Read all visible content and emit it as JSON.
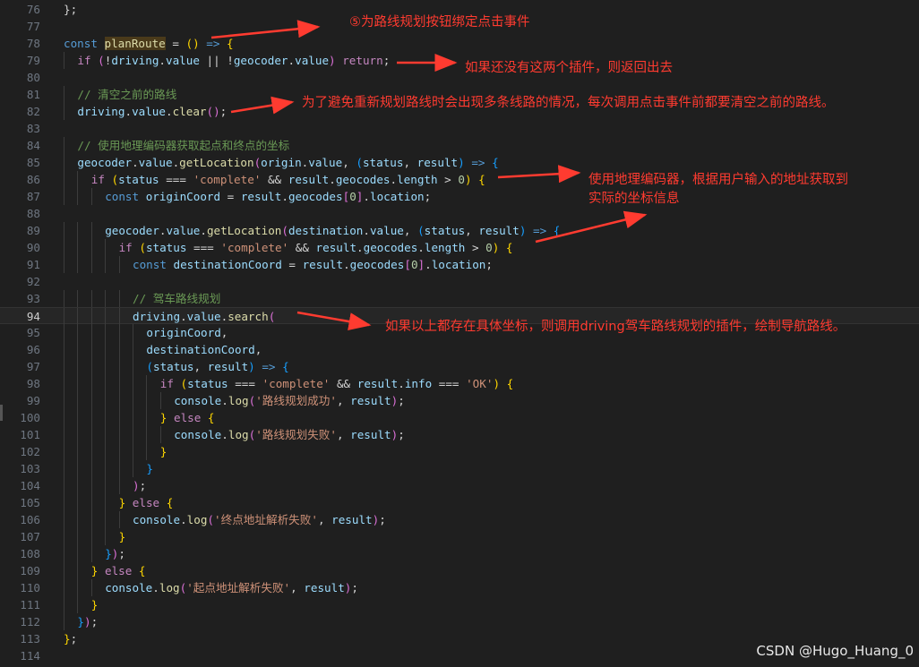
{
  "editor": {
    "active_line": 94,
    "lines": [
      {
        "no": 76,
        "indent": 0,
        "tokens": [
          [
            "p",
            "};"
          ]
        ]
      },
      {
        "no": 77,
        "indent": 0,
        "tokens": []
      },
      {
        "no": 78,
        "indent": 0,
        "tokens": [
          [
            "k",
            "const "
          ],
          [
            "hl",
            "planRoute"
          ],
          [
            "p",
            " = "
          ],
          [
            "b1",
            "()"
          ],
          [
            "p",
            " "
          ],
          [
            "k",
            "=>"
          ],
          [
            "p",
            " "
          ],
          [
            "b1",
            "{"
          ]
        ]
      },
      {
        "no": 79,
        "indent": 1,
        "tokens": [
          [
            "c",
            "if "
          ],
          [
            "b2",
            "("
          ],
          [
            "p",
            "!"
          ],
          [
            "v",
            "driving"
          ],
          [
            "p",
            "."
          ],
          [
            "v",
            "value"
          ],
          [
            "p",
            " || !"
          ],
          [
            "v",
            "geocoder"
          ],
          [
            "p",
            "."
          ],
          [
            "v",
            "value"
          ],
          [
            "b2",
            ")"
          ],
          [
            "p",
            " "
          ],
          [
            "c",
            "return"
          ],
          [
            "p",
            ";"
          ]
        ]
      },
      {
        "no": 80,
        "indent": 0,
        "tokens": []
      },
      {
        "no": 81,
        "indent": 1,
        "tokens": [
          [
            "cm",
            "// 清空之前的路线"
          ]
        ]
      },
      {
        "no": 82,
        "indent": 1,
        "tokens": [
          [
            "v",
            "driving"
          ],
          [
            "p",
            "."
          ],
          [
            "v",
            "value"
          ],
          [
            "p",
            "."
          ],
          [
            "f",
            "clear"
          ],
          [
            "b2",
            "()"
          ],
          [
            "p",
            ";"
          ]
        ]
      },
      {
        "no": 83,
        "indent": 0,
        "tokens": []
      },
      {
        "no": 84,
        "indent": 1,
        "tokens": [
          [
            "cm",
            "// 使用地理编码器获取起点和终点的坐标"
          ]
        ]
      },
      {
        "no": 85,
        "indent": 1,
        "tokens": [
          [
            "v",
            "geocoder"
          ],
          [
            "p",
            "."
          ],
          [
            "v",
            "value"
          ],
          [
            "p",
            "."
          ],
          [
            "f",
            "getLocation"
          ],
          [
            "b2",
            "("
          ],
          [
            "v",
            "origin"
          ],
          [
            "p",
            "."
          ],
          [
            "v",
            "value"
          ],
          [
            "p",
            ", "
          ],
          [
            "b3",
            "("
          ],
          [
            "v",
            "status"
          ],
          [
            "p",
            ", "
          ],
          [
            "v",
            "result"
          ],
          [
            "b3",
            ")"
          ],
          [
            "p",
            " "
          ],
          [
            "k",
            "=>"
          ],
          [
            "p",
            " "
          ],
          [
            "b3",
            "{"
          ]
        ]
      },
      {
        "no": 86,
        "indent": 2,
        "tokens": [
          [
            "c",
            "if "
          ],
          [
            "b1",
            "("
          ],
          [
            "v",
            "status"
          ],
          [
            "p",
            " === "
          ],
          [
            "s",
            "'complete'"
          ],
          [
            "p",
            " && "
          ],
          [
            "v",
            "result"
          ],
          [
            "p",
            "."
          ],
          [
            "v",
            "geocodes"
          ],
          [
            "p",
            "."
          ],
          [
            "v",
            "length"
          ],
          [
            "p",
            " > "
          ],
          [
            "n",
            "0"
          ],
          [
            "b1",
            ")"
          ],
          [
            "p",
            " "
          ],
          [
            "b1",
            "{"
          ]
        ]
      },
      {
        "no": 87,
        "indent": 3,
        "tokens": [
          [
            "k",
            "const "
          ],
          [
            "v",
            "originCoord"
          ],
          [
            "p",
            " = "
          ],
          [
            "v",
            "result"
          ],
          [
            "p",
            "."
          ],
          [
            "v",
            "geocodes"
          ],
          [
            "b2",
            "["
          ],
          [
            "n",
            "0"
          ],
          [
            "b2",
            "]"
          ],
          [
            "p",
            "."
          ],
          [
            "v",
            "location"
          ],
          [
            "p",
            ";"
          ]
        ]
      },
      {
        "no": 88,
        "indent": 0,
        "tokens": []
      },
      {
        "no": 89,
        "indent": 3,
        "tokens": [
          [
            "v",
            "geocoder"
          ],
          [
            "p",
            "."
          ],
          [
            "v",
            "value"
          ],
          [
            "p",
            "."
          ],
          [
            "f",
            "getLocation"
          ],
          [
            "b2",
            "("
          ],
          [
            "v",
            "destination"
          ],
          [
            "p",
            "."
          ],
          [
            "v",
            "value"
          ],
          [
            "p",
            ", "
          ],
          [
            "b3",
            "("
          ],
          [
            "v",
            "status"
          ],
          [
            "p",
            ", "
          ],
          [
            "v",
            "result"
          ],
          [
            "b3",
            ")"
          ],
          [
            "p",
            " "
          ],
          [
            "k",
            "=>"
          ],
          [
            "p",
            " "
          ],
          [
            "b3",
            "{"
          ]
        ]
      },
      {
        "no": 90,
        "indent": 4,
        "tokens": [
          [
            "c",
            "if "
          ],
          [
            "b1",
            "("
          ],
          [
            "v",
            "status"
          ],
          [
            "p",
            " === "
          ],
          [
            "s",
            "'complete'"
          ],
          [
            "p",
            " && "
          ],
          [
            "v",
            "result"
          ],
          [
            "p",
            "."
          ],
          [
            "v",
            "geocodes"
          ],
          [
            "p",
            "."
          ],
          [
            "v",
            "length"
          ],
          [
            "p",
            " > "
          ],
          [
            "n",
            "0"
          ],
          [
            "b1",
            ")"
          ],
          [
            "p",
            " "
          ],
          [
            "b1",
            "{"
          ]
        ]
      },
      {
        "no": 91,
        "indent": 5,
        "tokens": [
          [
            "k",
            "const "
          ],
          [
            "v",
            "destinationCoord"
          ],
          [
            "p",
            " = "
          ],
          [
            "v",
            "result"
          ],
          [
            "p",
            "."
          ],
          [
            "v",
            "geocodes"
          ],
          [
            "b2",
            "["
          ],
          [
            "n",
            "0"
          ],
          [
            "b2",
            "]"
          ],
          [
            "p",
            "."
          ],
          [
            "v",
            "location"
          ],
          [
            "p",
            ";"
          ]
        ]
      },
      {
        "no": 92,
        "indent": 0,
        "tokens": []
      },
      {
        "no": 93,
        "indent": 5,
        "tokens": [
          [
            "cm",
            "// 驾车路线规划"
          ]
        ]
      },
      {
        "no": 94,
        "indent": 5,
        "tokens": [
          [
            "v",
            "driving"
          ],
          [
            "p",
            "."
          ],
          [
            "v",
            "value"
          ],
          [
            "p",
            "."
          ],
          [
            "f",
            "search"
          ],
          [
            "b2",
            "("
          ]
        ]
      },
      {
        "no": 95,
        "indent": 6,
        "tokens": [
          [
            "v",
            "originCoord"
          ],
          [
            "p",
            ","
          ]
        ]
      },
      {
        "no": 96,
        "indent": 6,
        "tokens": [
          [
            "v",
            "destinationCoord"
          ],
          [
            "p",
            ","
          ]
        ]
      },
      {
        "no": 97,
        "indent": 6,
        "tokens": [
          [
            "b3",
            "("
          ],
          [
            "v",
            "status"
          ],
          [
            "p",
            ", "
          ],
          [
            "v",
            "result"
          ],
          [
            "b3",
            ")"
          ],
          [
            "p",
            " "
          ],
          [
            "k",
            "=>"
          ],
          [
            "p",
            " "
          ],
          [
            "b3",
            "{"
          ]
        ]
      },
      {
        "no": 98,
        "indent": 7,
        "tokens": [
          [
            "c",
            "if "
          ],
          [
            "b1",
            "("
          ],
          [
            "v",
            "status"
          ],
          [
            "p",
            " === "
          ],
          [
            "s",
            "'complete'"
          ],
          [
            "p",
            " && "
          ],
          [
            "v",
            "result"
          ],
          [
            "p",
            "."
          ],
          [
            "v",
            "info"
          ],
          [
            "p",
            " === "
          ],
          [
            "s",
            "'OK'"
          ],
          [
            "b1",
            ")"
          ],
          [
            "p",
            " "
          ],
          [
            "b1",
            "{"
          ]
        ]
      },
      {
        "no": 99,
        "indent": 8,
        "tokens": [
          [
            "v",
            "console"
          ],
          [
            "p",
            "."
          ],
          [
            "f",
            "log"
          ],
          [
            "b2",
            "("
          ],
          [
            "s",
            "'路线规划成功'"
          ],
          [
            "p",
            ", "
          ],
          [
            "v",
            "result"
          ],
          [
            "b2",
            ")"
          ],
          [
            "p",
            ";"
          ]
        ]
      },
      {
        "no": 100,
        "indent": 7,
        "tokens": [
          [
            "b1",
            "}"
          ],
          [
            "p",
            " "
          ],
          [
            "c",
            "else"
          ],
          [
            "p",
            " "
          ],
          [
            "b1",
            "{"
          ]
        ]
      },
      {
        "no": 101,
        "indent": 8,
        "tokens": [
          [
            "v",
            "console"
          ],
          [
            "p",
            "."
          ],
          [
            "f",
            "log"
          ],
          [
            "b2",
            "("
          ],
          [
            "s",
            "'路线规划失败'"
          ],
          [
            "p",
            ", "
          ],
          [
            "v",
            "result"
          ],
          [
            "b2",
            ")"
          ],
          [
            "p",
            ";"
          ]
        ]
      },
      {
        "no": 102,
        "indent": 7,
        "tokens": [
          [
            "b1",
            "}"
          ]
        ]
      },
      {
        "no": 103,
        "indent": 6,
        "tokens": [
          [
            "b3",
            "}"
          ]
        ]
      },
      {
        "no": 104,
        "indent": 5,
        "tokens": [
          [
            "b2",
            ")"
          ],
          [
            "p",
            ";"
          ]
        ]
      },
      {
        "no": 105,
        "indent": 4,
        "tokens": [
          [
            "b1",
            "}"
          ],
          [
            "p",
            " "
          ],
          [
            "c",
            "else"
          ],
          [
            "p",
            " "
          ],
          [
            "b1",
            "{"
          ]
        ]
      },
      {
        "no": 106,
        "indent": 5,
        "tokens": [
          [
            "v",
            "console"
          ],
          [
            "p",
            "."
          ],
          [
            "f",
            "log"
          ],
          [
            "b2",
            "("
          ],
          [
            "s",
            "'终点地址解析失败'"
          ],
          [
            "p",
            ", "
          ],
          [
            "v",
            "result"
          ],
          [
            "b2",
            ")"
          ],
          [
            "p",
            ";"
          ]
        ]
      },
      {
        "no": 107,
        "indent": 4,
        "tokens": [
          [
            "b1",
            "}"
          ]
        ]
      },
      {
        "no": 108,
        "indent": 3,
        "tokens": [
          [
            "b3",
            "}"
          ],
          [
            "b2",
            ")"
          ],
          [
            "p",
            ";"
          ]
        ]
      },
      {
        "no": 109,
        "indent": 2,
        "tokens": [
          [
            "b1",
            "}"
          ],
          [
            "p",
            " "
          ],
          [
            "c",
            "else"
          ],
          [
            "p",
            " "
          ],
          [
            "b1",
            "{"
          ]
        ]
      },
      {
        "no": 110,
        "indent": 3,
        "tokens": [
          [
            "v",
            "console"
          ],
          [
            "p",
            "."
          ],
          [
            "f",
            "log"
          ],
          [
            "b2",
            "("
          ],
          [
            "s",
            "'起点地址解析失败'"
          ],
          [
            "p",
            ", "
          ],
          [
            "v",
            "result"
          ],
          [
            "b2",
            ")"
          ],
          [
            "p",
            ";"
          ]
        ]
      },
      {
        "no": 111,
        "indent": 2,
        "tokens": [
          [
            "b1",
            "}"
          ]
        ]
      },
      {
        "no": 112,
        "indent": 1,
        "tokens": [
          [
            "b3",
            "}"
          ],
          [
            "b2",
            ")"
          ],
          [
            "p",
            ";"
          ]
        ]
      },
      {
        "no": 113,
        "indent": 0,
        "tokens": [
          [
            "b1",
            "}"
          ],
          [
            "p",
            ";"
          ]
        ]
      },
      {
        "no": 114,
        "indent": 0,
        "tokens": []
      }
    ]
  },
  "annotations": [
    {
      "id": "ann-1",
      "text": "⑤为路线规划按钮绑定点击事件"
    },
    {
      "id": "ann-2",
      "text": "如果还没有这两个插件，则返回出去"
    },
    {
      "id": "ann-3",
      "text": "为了避免重新规划路线时会出现多条线路的情况，每次调用点击事件前都要清空之前的路线。"
    },
    {
      "id": "ann-4a",
      "text": "使用地理编码器，根据用户输入的地址获取到"
    },
    {
      "id": "ann-4b",
      "text": "实际的坐标信息"
    },
    {
      "id": "ann-5",
      "text": "如果以上都存在具体坐标，则调用driving驾车路线规划的插件，绘制导航路线。"
    }
  ],
  "watermark": "CSDN @Hugo_Huang_0",
  "colors": {
    "background": "#1f1f1f",
    "annotation": "#ff3b30"
  }
}
